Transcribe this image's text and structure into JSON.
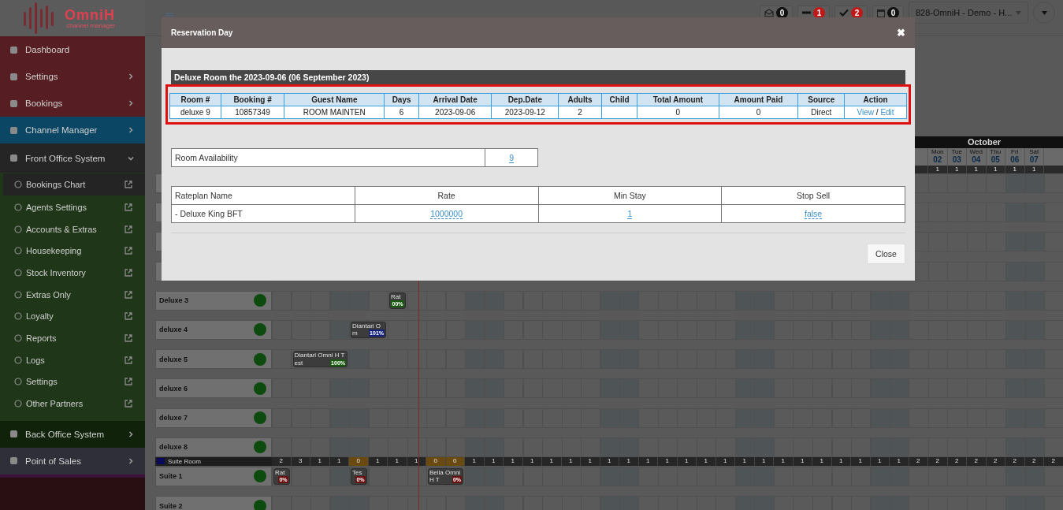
{
  "logo": {
    "name": "OmniH",
    "tagline": "channel manager"
  },
  "sidebar": {
    "items": [
      {
        "label": "Dashboard",
        "color": "#561e22",
        "expandable": false,
        "expanded": false
      },
      {
        "label": "Settings",
        "color": "#561e22",
        "expandable": true,
        "expanded": false
      },
      {
        "label": "Bookings",
        "color": "#561e22",
        "expandable": true,
        "expanded": false
      },
      {
        "label": "Channel Manager",
        "color": "#0b4764",
        "expandable": true,
        "expanded": false
      },
      {
        "label": "Front Office System",
        "color": "#252525",
        "expandable": true,
        "expanded": true,
        "children": [
          {
            "label": "Bookings Chart",
            "selected": true
          },
          {
            "label": "Agents Settings",
            "selected": false
          },
          {
            "label": "Accounts & Extras",
            "selected": false
          },
          {
            "label": "Housekeeping",
            "selected": false
          },
          {
            "label": "Stock Inventory",
            "selected": false
          },
          {
            "label": "Extras Only",
            "selected": false
          },
          {
            "label": "Loyalty",
            "selected": false
          },
          {
            "label": "Reports",
            "selected": false
          },
          {
            "label": "Logs",
            "selected": false
          },
          {
            "label": "Settings",
            "selected": false
          },
          {
            "label": "Other Partners",
            "selected": false
          }
        ]
      },
      {
        "label": "Back Office System",
        "color": "#10220a",
        "expandable": true,
        "expanded": false
      },
      {
        "label": "Point of Sales",
        "color": "#2e2f38",
        "expandable": true,
        "expanded": false
      }
    ]
  },
  "topbar": {
    "counters": [
      {
        "kind": "mail",
        "count": "0",
        "alert": false
      },
      {
        "kind": "minus",
        "count": "1",
        "alert": true
      },
      {
        "kind": "check",
        "count": "2",
        "alert": true
      },
      {
        "kind": "calendar",
        "count": "0",
        "alert": false
      }
    ],
    "property": "828-OmniH - Demo - H..."
  },
  "chart": {
    "month": "October",
    "days": [
      {
        "weekday": "Mon",
        "date": "02",
        "available": "1"
      },
      {
        "weekday": "Tue",
        "date": "03",
        "available": "1"
      },
      {
        "weekday": "Wed",
        "date": "04",
        "available": "1"
      },
      {
        "weekday": "Thu",
        "date": "05",
        "available": "1"
      },
      {
        "weekday": "Fri",
        "date": "06",
        "available": "1"
      },
      {
        "weekday": "Sat",
        "date": "07",
        "available": "1"
      }
    ],
    "rooms": [
      {
        "name": "Deluxe 3",
        "bookings": [
          {
            "guest": "Rat",
            "pct": "00%",
            "color": "#1a5a10"
          }
        ]
      },
      {
        "name": "deluxe 4",
        "bookings": [
          {
            "guest": "Diantari Om",
            "pct": "101%",
            "color": "#14207a"
          }
        ]
      },
      {
        "name": "deluxe 5",
        "bookings": [
          {
            "guest": "Diantari Omni H Test",
            "pct": "100%",
            "color": "#1a5a10"
          }
        ]
      },
      {
        "name": "deluxe 6"
      },
      {
        "name": "deluxe 7"
      },
      {
        "name": "deluxe 8"
      }
    ],
    "group": {
      "name": "Suite Room",
      "counts": [
        "2",
        "3",
        "1",
        "1",
        "0",
        "1",
        "1",
        "1",
        "0",
        "0",
        "1",
        "1",
        "1",
        "1",
        "1",
        "1",
        "1",
        "1",
        "1",
        "1",
        "1",
        "1",
        "1",
        "1",
        "1",
        "1",
        "1",
        "1",
        "1",
        "1",
        "1",
        "1",
        "1",
        "2",
        "2",
        "2",
        "2",
        "2",
        "2",
        "2",
        "2"
      ]
    },
    "suites": [
      {
        "name": "Suite 1",
        "bookings": [
          {
            "guest": "Rat",
            "pct": "0%",
            "color": "#6a1010"
          },
          {
            "guest": "Tes",
            "pct": "0%",
            "color": "#6a1010"
          },
          {
            "guest": "Bella OmniH T",
            "pct": "0%",
            "color": "#6a1010"
          }
        ]
      },
      {
        "name": "Suite 2"
      }
    ]
  },
  "modal": {
    "title": "Reservation Day",
    "close_icon": "✖",
    "heading": "Deluxe Room the 2023-09-06 (06 September 2023)",
    "reservation": {
      "columns": [
        "Room #",
        "Booking #",
        "Guest Name",
        "Days",
        "Arrival Date",
        "Dep.Date",
        "Adults",
        "Child",
        "Total Amount",
        "Amount Paid",
        "Source",
        "Action"
      ],
      "row": {
        "room": "deluxe 9",
        "booking": "10857349",
        "guest": "ROOM MAINTEN",
        "days": "6",
        "arrival": "2023-09-06",
        "departure": "2023-09-12",
        "adults": "2",
        "total": "0",
        "paid": "0",
        "source": "Direct",
        "view": "View",
        "sep": "/",
        "edit": "Edit"
      }
    },
    "availability": {
      "label": "Room Availability",
      "value": "9"
    },
    "rateplans": {
      "columns": [
        "Rateplan Name",
        "Rate",
        "Min Stay",
        "Stop Sell"
      ],
      "rows": [
        {
          "name": "- Deluxe King BFT",
          "rate": "1000000",
          "min_stay": "1",
          "stop_sell": "false"
        }
      ]
    },
    "button": "Close"
  }
}
